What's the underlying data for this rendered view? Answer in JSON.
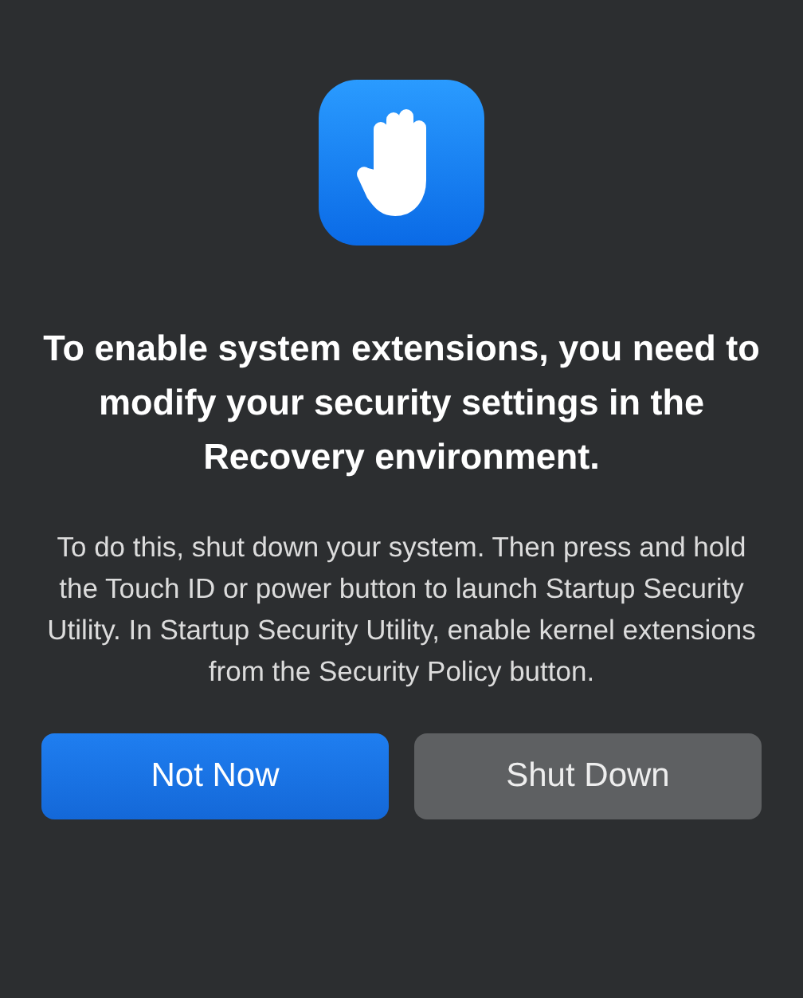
{
  "dialog": {
    "title": "To enable system extensions, you need to modify your security settings in the Recovery environment.",
    "message": "To do this, shut down your system. Then press and hold the Touch ID or power button to launch Startup Security Utility. In Startup Security Utility, enable kernel extensions from the Security Policy button.",
    "buttons": [
      {
        "label": "Not Now",
        "kind": "primary"
      },
      {
        "label": "Shut Down",
        "kind": "secondary"
      }
    ]
  }
}
